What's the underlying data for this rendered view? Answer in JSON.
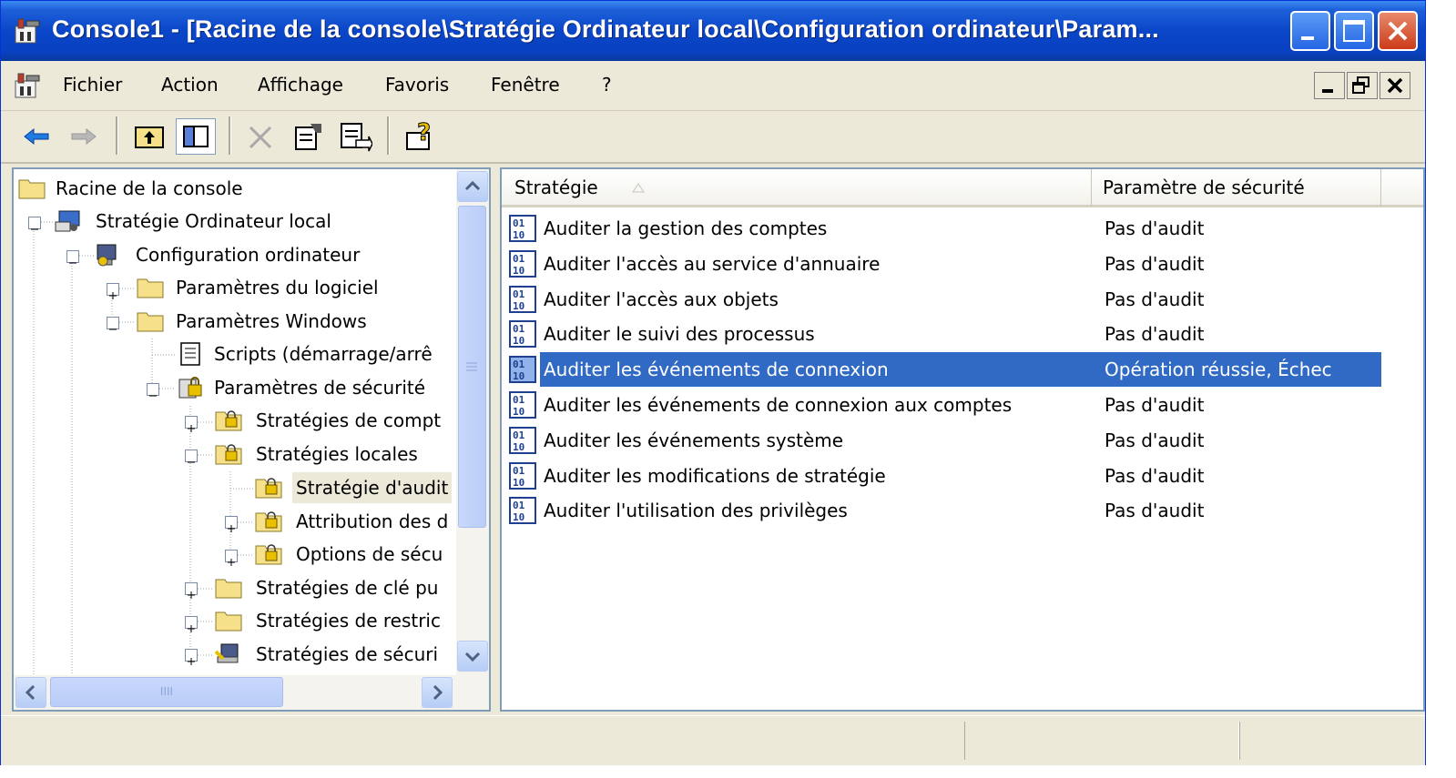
{
  "window": {
    "title": "Console1 - [Racine de la console\\Stratégie Ordinateur local\\Configuration ordinateur\\Param..."
  },
  "menubar": {
    "items": [
      "Fichier",
      "Action",
      "Affichage",
      "Favoris",
      "Fenêtre",
      "?"
    ]
  },
  "toolbar": {
    "buttons": [
      "back-icon",
      "forward-icon",
      "up-folder-icon",
      "show-hide-tree-icon",
      "delete-icon",
      "properties-icon",
      "export-list-icon",
      "help-icon"
    ]
  },
  "tree": {
    "items": [
      {
        "label": "Racine de la console",
        "icon": "folder-icon"
      },
      {
        "label": "Stratégie Ordinateur local",
        "icon": "computer-policy-icon"
      },
      {
        "label": "Configuration ordinateur",
        "icon": "computer-config-icon"
      },
      {
        "label": "Paramètres du logiciel",
        "icon": "folder-icon"
      },
      {
        "label": "Paramètres Windows",
        "icon": "folder-icon"
      },
      {
        "label": "Scripts (démarrage/arrê",
        "icon": "script-icon"
      },
      {
        "label": "Paramètres de sécurité",
        "icon": "security-icon"
      },
      {
        "label": "Stratégies de compt",
        "icon": "locked-folder-icon"
      },
      {
        "label": "Stratégies locales",
        "icon": "locked-folder-icon"
      },
      {
        "label": "Stratégie d'audit",
        "icon": "locked-folder-icon"
      },
      {
        "label": "Attribution des d",
        "icon": "locked-folder-icon"
      },
      {
        "label": "Options de sécu",
        "icon": "locked-folder-icon"
      },
      {
        "label": "Stratégies de clé pu",
        "icon": "folder-icon"
      },
      {
        "label": "Stratégies de restric",
        "icon": "folder-icon"
      },
      {
        "label": "Stratégies de sécuri",
        "icon": "ip-security-icon"
      }
    ],
    "scrollbar_label": "IIII"
  },
  "list": {
    "columns": [
      "Stratégie",
      "Paramètre de sécurité"
    ],
    "rows": [
      {
        "policy": "Auditer la gestion des comptes",
        "setting": "Pas d'audit"
      },
      {
        "policy": "Auditer l'accès au service d'annuaire",
        "setting": "Pas d'audit"
      },
      {
        "policy": "Auditer l'accès aux objets",
        "setting": "Pas d'audit"
      },
      {
        "policy": "Auditer le suivi des processus",
        "setting": "Pas d'audit"
      },
      {
        "policy": "Auditer les événements de connexion",
        "setting": "Opération réussie, Échec",
        "selected": true
      },
      {
        "policy": "Auditer les événements de connexion aux comptes",
        "setting": "Pas d'audit"
      },
      {
        "policy": "Auditer les événements système",
        "setting": "Pas d'audit"
      },
      {
        "policy": "Auditer les modifications de stratégie",
        "setting": "Pas d'audit"
      },
      {
        "policy": "Auditer l'utilisation des privilèges",
        "setting": "Pas d'audit"
      }
    ]
  },
  "colors": {
    "selection": "#316ac5",
    "titlebar": "#0a46c9",
    "chrome": "#ece9d8"
  }
}
